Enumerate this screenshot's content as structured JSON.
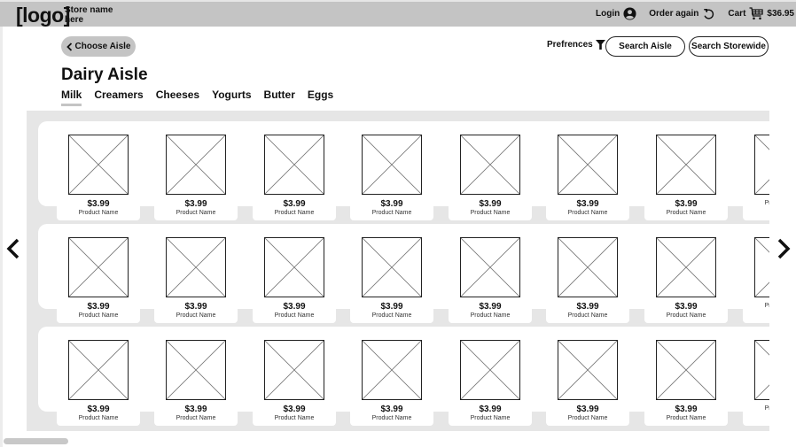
{
  "header": {
    "logo": "[logo]",
    "store_name": "Store name here",
    "login_label": "Login",
    "order_again_label": "Order again",
    "cart_label": "Cart",
    "cart_total": "$36.95",
    "icons": {
      "login": "user-circle-icon",
      "order_again": "undo-arrow-icon",
      "cart": "shopping-cart-icon"
    }
  },
  "toolbar": {
    "choose_aisle_label": "Choose Aisle",
    "preferences_label": "Prefrences",
    "search_aisle_label": "Search Aisle",
    "search_storewide_label": "Search Storewide"
  },
  "aisle": {
    "title": "Dairy Aisle",
    "tabs": [
      {
        "label": "Milk",
        "active": true
      },
      {
        "label": "Creamers",
        "active": false
      },
      {
        "label": "Cheeses",
        "active": false
      },
      {
        "label": "Yogurts",
        "active": false
      },
      {
        "label": "Butter",
        "active": false
      },
      {
        "label": "Eggs",
        "active": false
      }
    ]
  },
  "shelves": [
    {
      "products": [
        {
          "price": "$3.99",
          "name": "Product Name"
        },
        {
          "price": "$3.99",
          "name": "Product Name"
        },
        {
          "price": "$3.99",
          "name": "Product Name"
        },
        {
          "price": "$3.99",
          "name": "Product Name"
        },
        {
          "price": "$3.99",
          "name": "Product Name"
        },
        {
          "price": "$3.99",
          "name": "Product Name"
        },
        {
          "price": "$3.99",
          "name": "Product Name"
        },
        {
          "price": "",
          "name": "Product Name"
        }
      ]
    },
    {
      "products": [
        {
          "price": "$3.99",
          "name": "Product Name"
        },
        {
          "price": "$3.99",
          "name": "Product Name"
        },
        {
          "price": "$3.99",
          "name": "Product Name"
        },
        {
          "price": "$3.99",
          "name": "Product Name"
        },
        {
          "price": "$3.99",
          "name": "Product Name"
        },
        {
          "price": "$3.99",
          "name": "Product Name"
        },
        {
          "price": "$3.99",
          "name": "Product Name"
        },
        {
          "price": "",
          "name": "Product Name"
        }
      ]
    },
    {
      "products": [
        {
          "price": "$3.99",
          "name": "Product Name"
        },
        {
          "price": "$3.99",
          "name": "Product Name"
        },
        {
          "price": "$3.99",
          "name": "Product Name"
        },
        {
          "price": "$3.99",
          "name": "Product Name"
        },
        {
          "price": "$3.99",
          "name": "Product Name"
        },
        {
          "price": "$3.99",
          "name": "Product Name"
        },
        {
          "price": "$3.99",
          "name": "Product Name"
        },
        {
          "price": "",
          "name": "Product Name"
        }
      ]
    }
  ],
  "navigation": {
    "prev_icon": "chevron-left-icon",
    "next_icon": "chevron-right-icon"
  }
}
